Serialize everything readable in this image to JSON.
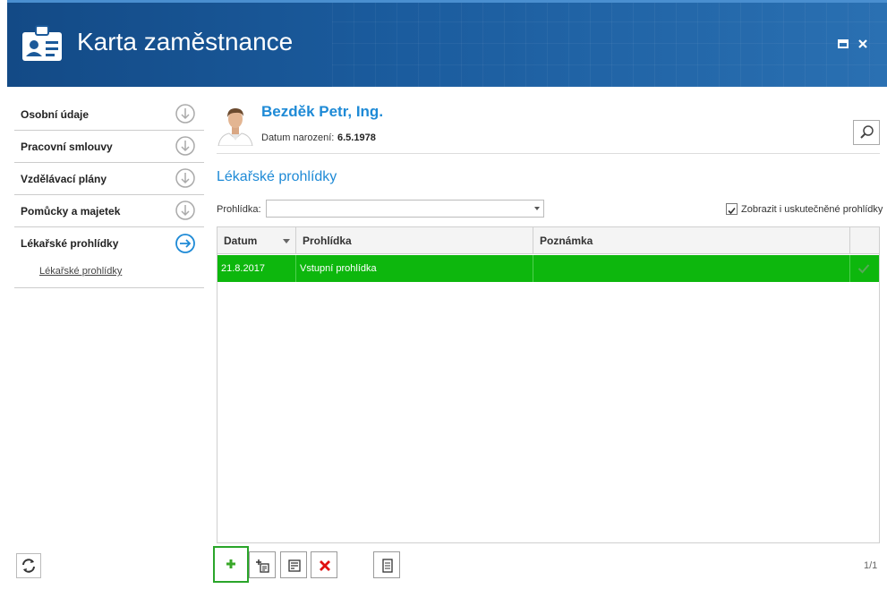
{
  "window": {
    "title": "Karta zaměstnance",
    "accent": "#1c5a9a",
    "app_icon": "id-card-icon"
  },
  "sidebar": {
    "items": [
      {
        "label": "Osobní údaje",
        "icon": "arrow-down-circle-icon"
      },
      {
        "label": "Pracovní smlouvy",
        "icon": "arrow-down-circle-icon"
      },
      {
        "label": "Vzdělávací plány",
        "icon": "arrow-down-circle-icon"
      },
      {
        "label": "Pomůcky a majetek",
        "icon": "arrow-down-circle-icon"
      },
      {
        "label": "Lékařské prohlídky",
        "icon": "arrow-right-circle-icon",
        "active": true,
        "sub_label": "Lékařské prohlídky"
      }
    ]
  },
  "employee": {
    "name": "Bezděk Petr, Ing.",
    "dob_label": "Datum narození:",
    "dob_value": "6.5.1978"
  },
  "section": {
    "title": "Lékařské prohlídky"
  },
  "filter": {
    "label": "Prohlídka:",
    "value": "",
    "checkbox_label": "Zobrazit i uskutečněné prohlídky",
    "checkbox_checked": true
  },
  "grid": {
    "columns": [
      "Datum",
      "Prohlídka",
      "Poznámka",
      ""
    ],
    "rows": [
      {
        "datum": "21.8.2017",
        "prohlidka": "Vstupní prohlídka",
        "poznamka": "",
        "done": true,
        "color": "#0db70d"
      }
    ]
  },
  "toolbar": {
    "buttons": [
      "add-icon",
      "copy-new-icon",
      "edit-icon",
      "delete-icon",
      "document-icon"
    ]
  },
  "pager": {
    "text": "1/1"
  }
}
